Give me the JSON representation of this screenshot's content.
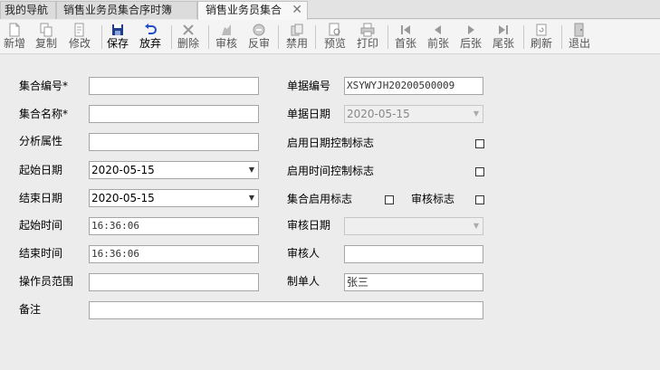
{
  "tabs": [
    {
      "label": "我的导航"
    },
    {
      "label": "销售业务员集合序时簿"
    },
    {
      "label": "销售业务员集合"
    }
  ],
  "toolbar": {
    "new": "新增",
    "copy": "复制",
    "modify": "修改",
    "save": "保存",
    "discard": "放弃",
    "delete": "删除",
    "audit": "审核",
    "unaudit": "反审",
    "disable": "禁用",
    "preview": "预览",
    "print": "打印",
    "first": "首张",
    "prev": "前张",
    "next": "后张",
    "last": "尾张",
    "refresh": "刷新",
    "exit": "退出"
  },
  "form": {
    "set_code_label": "集合编号*",
    "set_code_value": "",
    "set_name_label": "集合名称*",
    "set_name_value": "",
    "analysis_label": "分析属性",
    "analysis_value": "",
    "start_date_label": "起始日期",
    "start_date_value": "2020-05-15",
    "end_date_label": "结束日期",
    "end_date_value": "2020-05-15",
    "start_time_label": "起始时间",
    "start_time_value": "16:36:06",
    "end_time_label": "结束时间",
    "end_time_value": "16:36:06",
    "operator_range_label": "操作员范围",
    "operator_range_value": "",
    "remark_label": "备注",
    "remark_value": "",
    "doc_no_label": "单据编号",
    "doc_no_value": "XSYWYJH20200500009",
    "doc_date_label": "单据日期",
    "doc_date_value": "2020-05-15",
    "enable_date_ctrl_label": "启用日期控制标志",
    "enable_time_ctrl_label": "启用时间控制标志",
    "set_enable_label": "集合启用标志",
    "audit_flag_label": "审核标志",
    "audit_date_label": "审核日期",
    "audit_date_value": "",
    "auditor_label": "审核人",
    "auditor_value": "",
    "maker_label": "制单人",
    "maker_value": "张三"
  }
}
